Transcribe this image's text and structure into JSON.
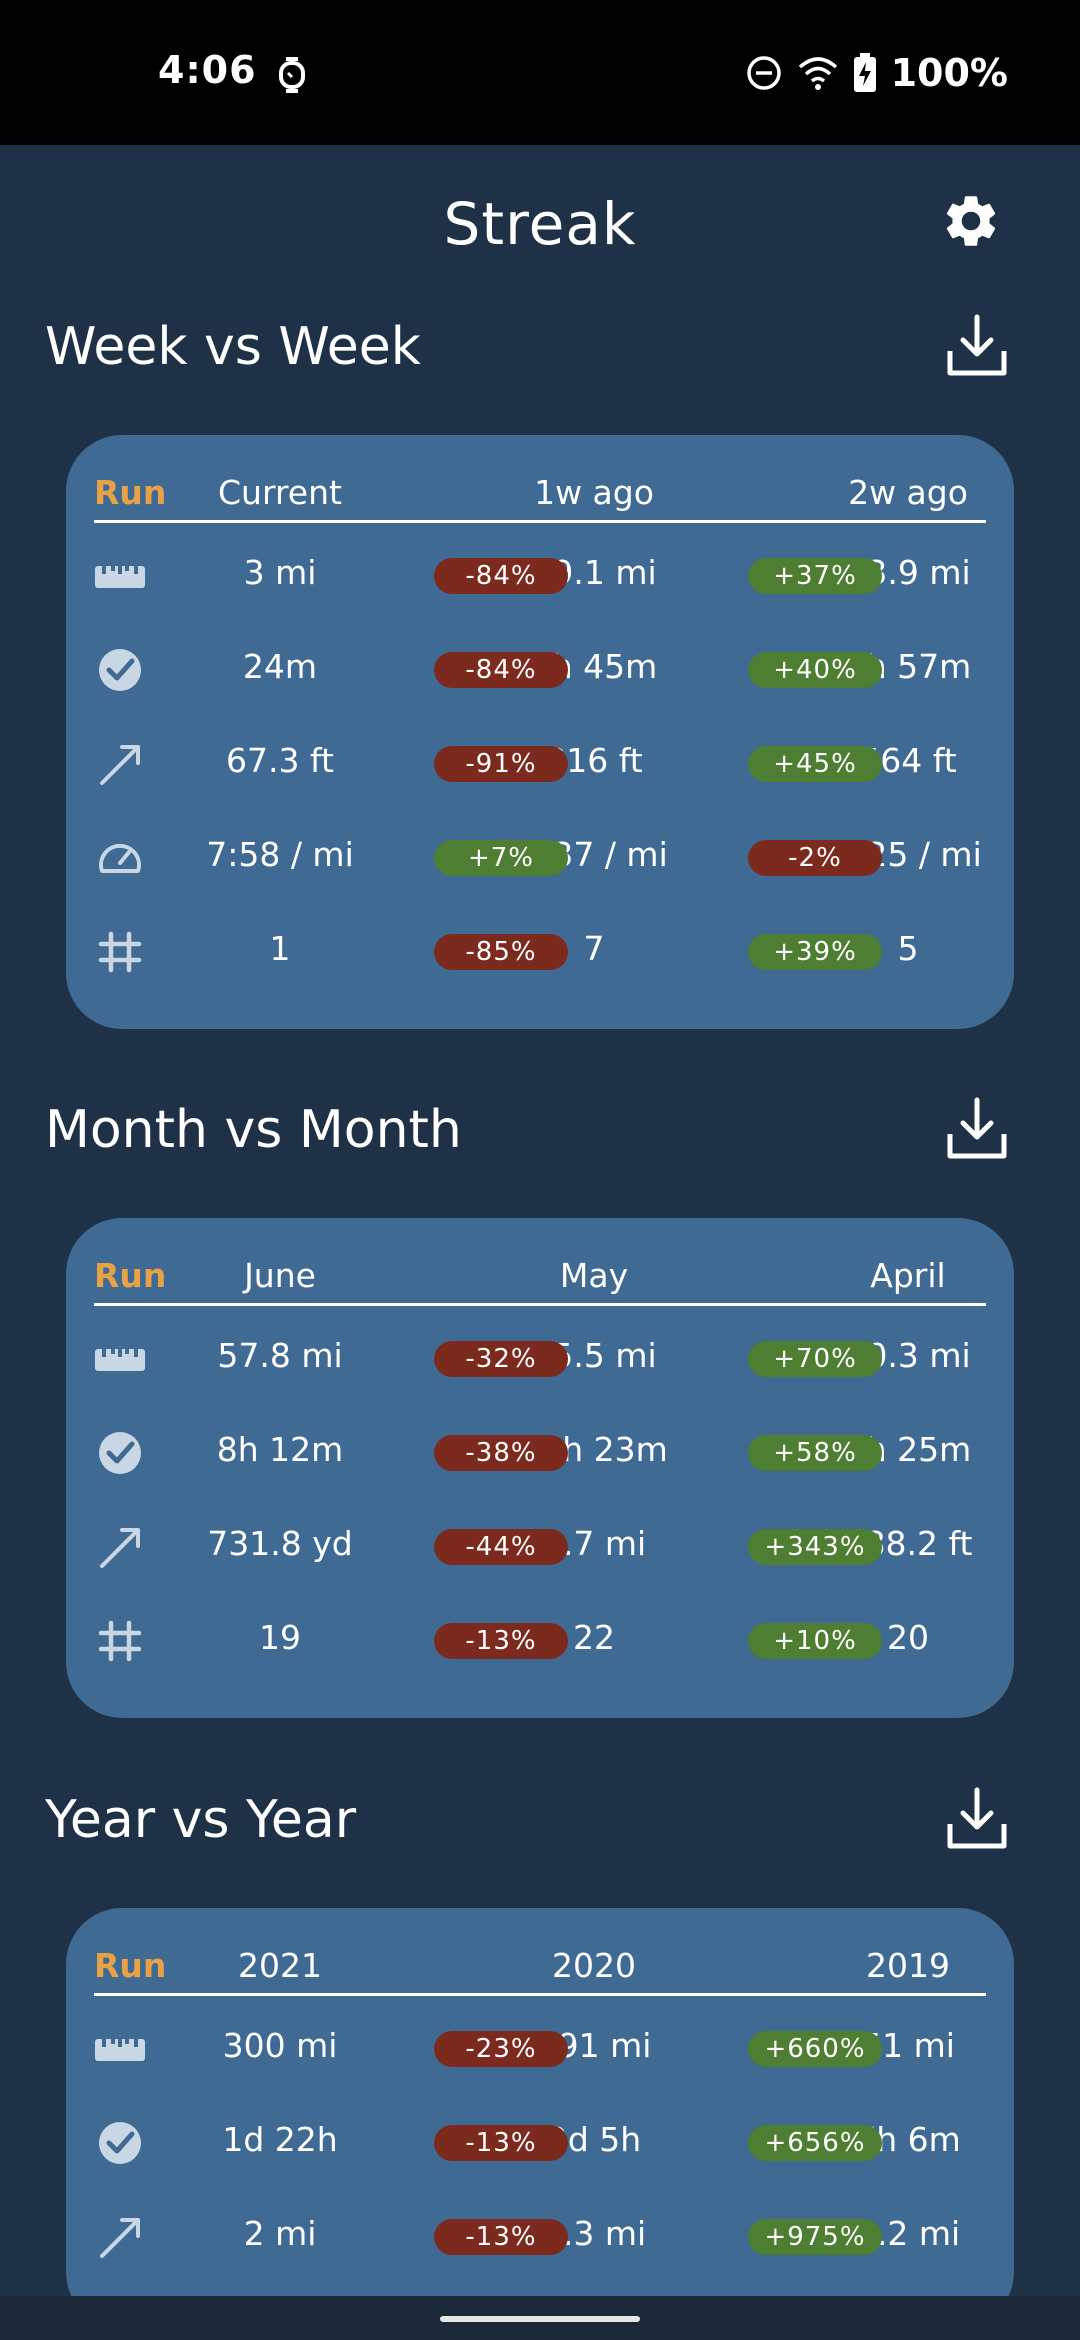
{
  "status": {
    "time": "4:06",
    "battery": "100%"
  },
  "app": {
    "title": "Streak"
  },
  "colors": {
    "accent": "#e8a245",
    "negative": "#7c2a1d",
    "positive": "#4d7e31",
    "card": "#3f6a93",
    "background": "#1e3147"
  },
  "sections": [
    {
      "title": "Week vs Week",
      "sport": "Run",
      "columns": [
        "Current",
        "1w ago",
        "2w ago"
      ],
      "rows": [
        {
          "icon": "ruler-icon",
          "values": [
            "3 mi",
            "19.1 mi",
            "13.9 mi"
          ],
          "changes": [
            {
              "text": "-84%",
              "dir": "neg"
            },
            {
              "text": "+37%",
              "dir": "pos"
            }
          ]
        },
        {
          "icon": "clock-check-icon",
          "values": [
            "24m",
            "2h 45m",
            "1h 57m"
          ],
          "changes": [
            {
              "text": "-84%",
              "dir": "neg"
            },
            {
              "text": "+40%",
              "dir": "pos"
            }
          ]
        },
        {
          "icon": "elevation-arrow-icon",
          "values": [
            "67.3 ft",
            "816 ft",
            "564 ft"
          ],
          "changes": [
            {
              "text": "-91%",
              "dir": "neg"
            },
            {
              "text": "+45%",
              "dir": "pos"
            }
          ]
        },
        {
          "icon": "speedometer-icon",
          "values": [
            "7:58 / mi",
            "8:37 / mi",
            "8:25 / mi"
          ],
          "changes": [
            {
              "text": "+7%",
              "dir": "pos"
            },
            {
              "text": "-2%",
              "dir": "neg"
            }
          ]
        },
        {
          "icon": "hash-icon",
          "values": [
            "1",
            "7",
            "5"
          ],
          "changes": [
            {
              "text": "-85%",
              "dir": "neg"
            },
            {
              "text": "+39%",
              "dir": "pos"
            }
          ]
        }
      ]
    },
    {
      "title": "Month vs Month",
      "sport": "Run",
      "columns": [
        "June",
        "May",
        "April"
      ],
      "rows": [
        {
          "icon": "ruler-icon",
          "values": [
            "57.8 mi",
            "85.5 mi",
            "50.3 mi"
          ],
          "changes": [
            {
              "text": "-32%",
              "dir": "neg"
            },
            {
              "text": "+70%",
              "dir": "pos"
            }
          ]
        },
        {
          "icon": "clock-check-icon",
          "values": [
            "8h 12m",
            "13h 23m",
            "8h 25m"
          ],
          "changes": [
            {
              "text": "-38%",
              "dir": "neg"
            },
            {
              "text": "+58%",
              "dir": "pos"
            }
          ]
        },
        {
          "icon": "elevation-arrow-icon",
          "values": [
            "731.8 yd",
            "0.7 mi",
            "888.2 ft"
          ],
          "changes": [
            {
              "text": "-44%",
              "dir": "neg"
            },
            {
              "text": "+343%",
              "dir": "pos"
            }
          ]
        },
        {
          "icon": "hash-icon",
          "values": [
            "19",
            "22",
            "20"
          ],
          "changes": [
            {
              "text": "-13%",
              "dir": "neg"
            },
            {
              "text": "+10%",
              "dir": "pos"
            }
          ]
        }
      ]
    },
    {
      "title": "Year vs Year",
      "sport": "Run",
      "columns": [
        "2021",
        "2020",
        "2019"
      ],
      "rows": [
        {
          "icon": "ruler-icon",
          "values": [
            "300 mi",
            "391 mi",
            "51 mi"
          ],
          "changes": [
            {
              "text": "-23%",
              "dir": "neg"
            },
            {
              "text": "+660%",
              "dir": "pos"
            }
          ]
        },
        {
          "icon": "clock-check-icon",
          "values": [
            "1d 22h",
            "2d 5h",
            "7h 6m"
          ],
          "changes": [
            {
              "text": "-13%",
              "dir": "neg"
            },
            {
              "text": "+656%",
              "dir": "pos"
            }
          ]
        },
        {
          "icon": "elevation-arrow-icon",
          "values": [
            "2 mi",
            "2.3 mi",
            "0.2 mi"
          ],
          "changes": [
            {
              "text": "-13%",
              "dir": "neg"
            },
            {
              "text": "+975%",
              "dir": "pos"
            }
          ]
        }
      ]
    }
  ]
}
